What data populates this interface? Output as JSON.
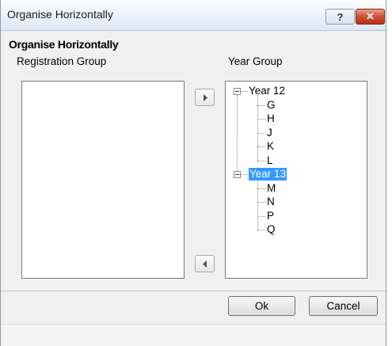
{
  "window": {
    "title": "Organise Horizontally",
    "help_glyph": "?",
    "close_glyph": "✕"
  },
  "section_title": "Organise Horizontally",
  "registration_group": {
    "label": "Registration Group",
    "items": []
  },
  "year_group": {
    "label": "Year Group",
    "tree": [
      {
        "label": "Year 12",
        "expanded": true,
        "selected": false,
        "children": [
          "G",
          "H",
          "J",
          "K",
          "L"
        ]
      },
      {
        "label": "Year 13",
        "expanded": true,
        "selected": true,
        "children": [
          "M",
          "N",
          "P",
          "Q"
        ]
      }
    ]
  },
  "buttons": {
    "move_right_icon": "triangle-right-icon",
    "move_left_icon": "triangle-left-icon",
    "ok": "Ok",
    "cancel": "Cancel"
  },
  "colors": {
    "selection": "#3399ff",
    "close_button": "#c9462b"
  }
}
